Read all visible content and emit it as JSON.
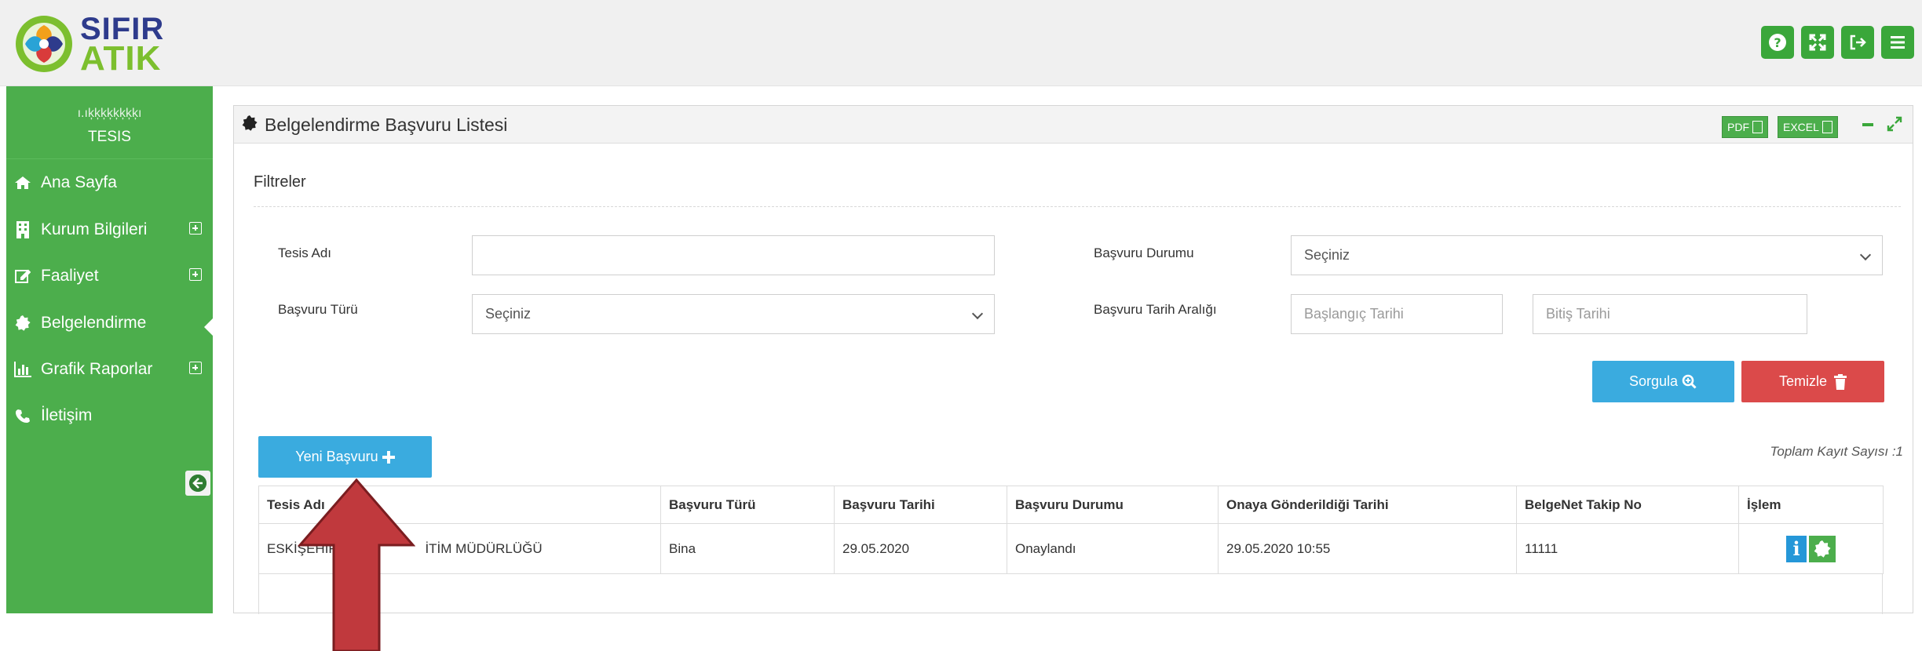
{
  "logo": {
    "line1": "SIFIR",
    "line2": "ATIK"
  },
  "top_icons": [
    {
      "name": "help-icon",
      "glyph": "?"
    },
    {
      "name": "fullscreen-icon",
      "glyph": "⛶"
    },
    {
      "name": "logout-icon",
      "glyph": "⇥"
    },
    {
      "name": "menu-icon",
      "glyph": "☰"
    }
  ],
  "sidebar": {
    "user_name": "ı.ıķķķķķķķķı",
    "user_role": "TESIS",
    "items": [
      {
        "label": "Ana Sayfa",
        "icon": "home-icon"
      },
      {
        "label": "Kurum Bilgileri",
        "icon": "building-icon"
      },
      {
        "label": "Faaliyet",
        "icon": "edit-icon"
      },
      {
        "label": "Belgelendirme",
        "icon": "certificate-icon"
      },
      {
        "label": "Grafik Raporlar",
        "icon": "bar-chart-icon"
      },
      {
        "label": "İletişim",
        "icon": "phone-icon"
      }
    ],
    "active": "Belgelendirme"
  },
  "panel": {
    "title": "Belgelendirme Başvuru Listesi",
    "pdf_label": "PDF",
    "excel_label": "EXCEL"
  },
  "filters": {
    "title": "Filtreler",
    "tesis_adi_label": "Tesis Adı",
    "tesis_adi_value": "",
    "basvuru_durumu_label": "Başvuru Durumu",
    "basvuru_durumu_value": "Seçiniz",
    "basvuru_turu_label": "Başvuru Türü",
    "basvuru_turu_value": "Seçiniz",
    "tarih_araligi_label": "Başvuru Tarih Aralığı",
    "baslangic_placeholder": "Başlangıç Tarihi",
    "bitis_placeholder": "Bitiş Tarihi"
  },
  "buttons": {
    "query": "Sorgula",
    "clear": "Temizle",
    "new_application": "Yeni Başvuru"
  },
  "total_records": "Toplam Kayıt Sayısı :1",
  "table": {
    "headers": [
      "Tesis Adı",
      "Başvuru Türü",
      "Başvuru Tarihi",
      "Başvuru Durumu",
      "Onaya Gönderildiği Tarihi",
      "BelgeNet Takip No",
      "İşlem"
    ],
    "rows": [
      {
        "tesis_adi": "ESKİŞEHİR",
        "tesis_adi_tail": "İTİM MÜDÜRLÜĞÜ",
        "basvuru_turu": "Bina",
        "basvuru_tarihi": "29.05.2020",
        "basvuru_durumu": "Onaylandı",
        "onaya_gonderildigi_tarihi": "29.05.2020 10:55",
        "belgenet_takip_no": "11111"
      }
    ]
  },
  "colors": {
    "brand_green": "#4cae4c",
    "button_blue": "#3aabdf",
    "button_red": "#db4a4a",
    "arrow_red": "#c0393d"
  }
}
